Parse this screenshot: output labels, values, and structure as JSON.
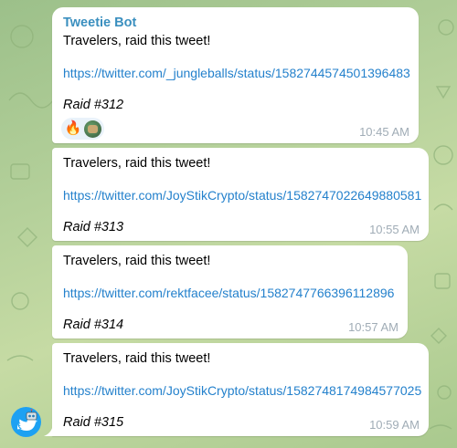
{
  "chat": {
    "bot_name": "Tweetie Bot",
    "messages": [
      {
        "text": "Travelers, raid this tweet!",
        "link": "https://twitter.com/_jungleballs/status/1582744574501396483",
        "raid": "Raid #312",
        "time": "10:45 AM",
        "reactions": [
          {
            "emoji": "🔥",
            "icon": "fire-icon"
          },
          {
            "icon": "user-avatar-reaction"
          }
        ]
      },
      {
        "text": "Travelers, raid this tweet!",
        "link": "https://twitter.com/JoyStikCrypto/status/1582747022649880581",
        "raid": "Raid #313",
        "time": "10:55 AM"
      },
      {
        "text": "Travelers, raid this tweet!",
        "link": "https://twitter.com/rektfacee/status/1582747766396112896",
        "raid": "Raid #314",
        "time": "10:57 AM"
      },
      {
        "text": "Travelers, raid this tweet!",
        "link": "https://twitter.com/JoyStikCrypto/status/1582748174984577025",
        "raid": "Raid #315",
        "time": "10:59 AM"
      }
    ]
  },
  "colors": {
    "sender_name": "#3a8fbf",
    "link": "#2481cc",
    "timestamp": "#a0acb6",
    "bot_avatar": "#1da1f2",
    "wallpaper": "#b4d09a"
  },
  "icons": {
    "bot_avatar": "twitter-bird-robot-icon"
  }
}
